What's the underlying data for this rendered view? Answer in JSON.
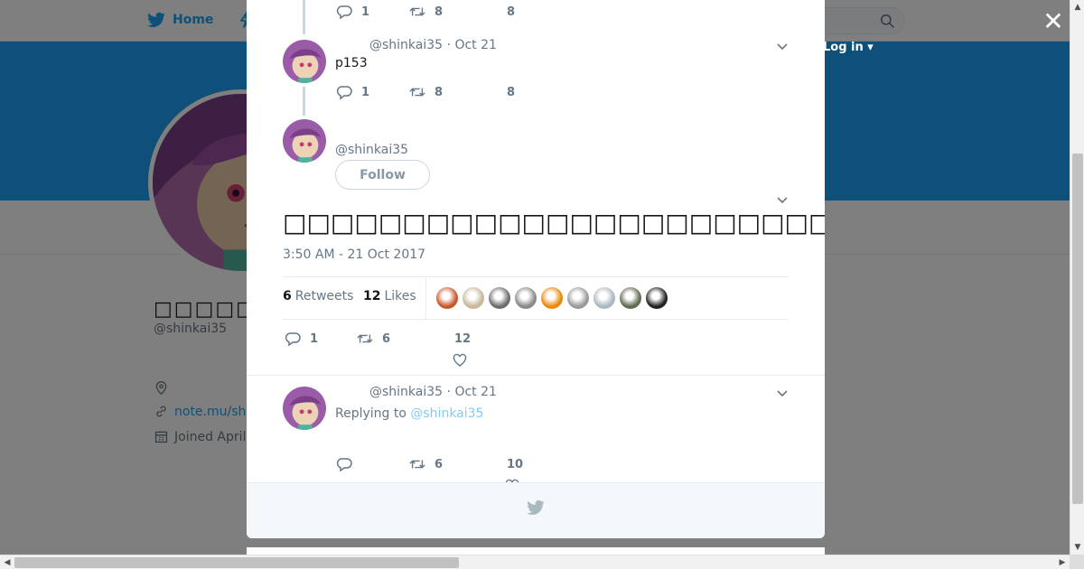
{
  "nav": {
    "home_label": "Home",
    "login_label": "Log in",
    "login_caret": "▾"
  },
  "profile": {
    "display_name": "□□□□□□□□□□□",
    "handle": "@shinkai35",
    "website": "note.mu/sh",
    "joined": "Joined April"
  },
  "modal": {
    "close_label": "✕",
    "thread": [
      {
        "actions": {
          "replies": "1",
          "retweets": "8",
          "likes": "8"
        }
      },
      {
        "handle": "@shinkai35",
        "sep": "·",
        "date": "Oct 21",
        "text": "p153",
        "actions": {
          "replies": "1",
          "retweets": "8",
          "likes": "8"
        }
      }
    ],
    "main_tweet": {
      "handle": "@shinkai35",
      "follow_label": "Follow",
      "text": "□□□□□□□□□□□□□□□□□□□□□□□□□□□□□□□□□□□□□□□□□□□□□□□□□□□□□",
      "timestamp": "3:50 AM - 21 Oct 2017",
      "retweet_count": "6",
      "retweet_label": "Retweets",
      "like_count": "12",
      "like_label": "Likes",
      "liker_colors": [
        "#c9572b",
        "#c8b89a",
        "#6d6d6d",
        "#8a8a8a",
        "#e88b0c",
        "#9a9a9a",
        "#aab8c2",
        "#5f6e52",
        "#222222"
      ],
      "actions": {
        "replies": "1",
        "retweets": "6",
        "likes": "12"
      }
    },
    "reply_tweet": {
      "handle": "@shinkai35",
      "sep": "·",
      "date": "Oct 21",
      "replying_prefix": "Replying to",
      "replying_handle": "@shinkai35",
      "actions": {
        "replies": "",
        "retweets": "6",
        "likes": "10"
      }
    }
  },
  "colors": {
    "brand": "#1da1f2",
    "muted": "#657786",
    "border": "#e6ecf0"
  }
}
